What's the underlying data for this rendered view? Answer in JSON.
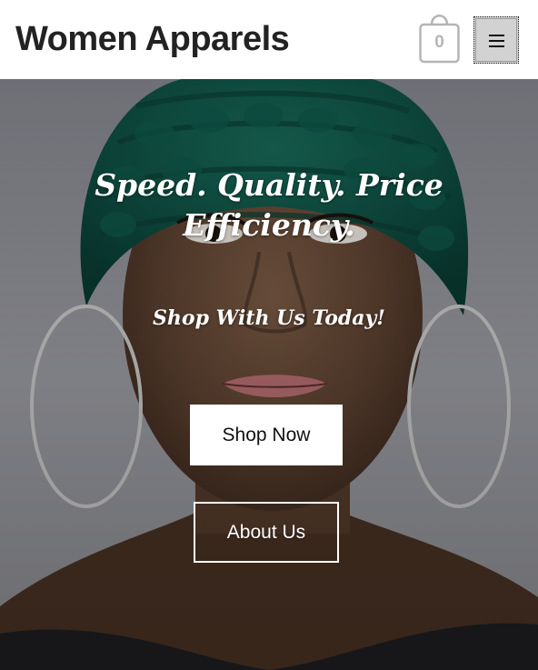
{
  "header": {
    "site_title": "Women Apparels",
    "cart_count": "0"
  },
  "icons": {
    "cart": "shopping-bag-icon",
    "menu": "hamburger-menu-icon"
  },
  "hero": {
    "heading": "Speed. Quality. Price Efficiency.",
    "subheading": "Shop With Us Today!",
    "primary_button": "Shop Now",
    "secondary_button": "About Us"
  },
  "colors": {
    "header_bg": "#ffffff",
    "title_text": "#222222",
    "cart_gray": "#b5b5b5",
    "menu_button_bg": "#d2d2d2",
    "hero_text": "#ffffff",
    "headwrap_green": "#0d4a40"
  }
}
